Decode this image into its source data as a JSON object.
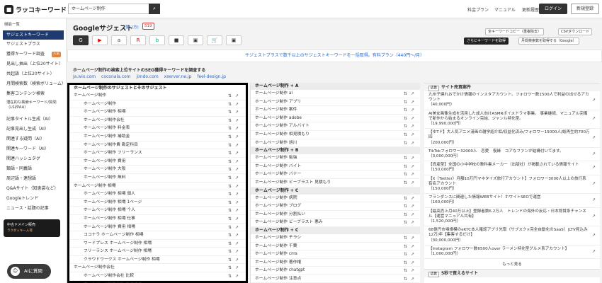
{
  "header": {
    "logo_text": "ラッコキーワード",
    "logo_mark": "■",
    "search_value": "ホームページ制作",
    "nav": [
      "料金プラン",
      "マニュアル",
      "更新履歴"
    ],
    "bell": "♪",
    "login": "ログイン",
    "signup": "新規登録"
  },
  "sidebar": {
    "heading": "機能一覧",
    "items": [
      {
        "label": "サジェストキーワード",
        "active": true
      },
      {
        "label": "サジェストプラス"
      },
      {
        "label": "獲得キーワード調査",
        "badge": "人気"
      },
      {
        "label": "見出し抽出（上位20サイト）"
      },
      {
        "label": "共起語（上位20サイト）"
      },
      {
        "label": "月間検索数（検索ボリューム）"
      },
      {
        "label": "集客コンテンツ検索"
      },
      {
        "label": "潜在的な検索キーワード/質問（LSI/PAA）"
      },
      {
        "label": "記事タイトル生成（AI）"
      },
      {
        "label": "記事見出し生成（AI）"
      },
      {
        "label": "関連する疑問（AI）"
      },
      {
        "label": "関連キーワード（AI）"
      },
      {
        "label": "関連ハッシュタグ"
      },
      {
        "label": "類語・同義語"
      },
      {
        "label": "周辺語・連想語"
      },
      {
        "label": "Q&Aサイト（知恵袋など）"
      },
      {
        "label": "Googleトレンド"
      },
      {
        "label": "ニュース・話題の記事"
      }
    ],
    "promo": {
      "title": "中古ドメイン販売",
      "sub": "ラクダッキー入荷"
    },
    "ai_button": "AIに質問"
  },
  "main": {
    "title": "Googleサジェスト",
    "howto": "(使い方)",
    "count": "519",
    "tools": [
      "G",
      "▶",
      "a",
      "R",
      "b",
      "■",
      "▣",
      "🛒",
      "▣"
    ],
    "right_buttons": {
      "copy": "全キーワードコピー（重複除去）",
      "csv": "CSVダウンロード",
      "more": "さらにキーワードを取得",
      "monthly": "月間検索数を取得する（Google）"
    },
    "info": "サジェストプラスで数千以上のサジェストキーワードを一括取得。有料プラン（440円〜/月）",
    "top_sites_heading": "ホームページ制作の検索上位サイトのSEO獲得キーワードを調査する",
    "top_sites": [
      "ja.wix.com",
      "coconala.com",
      "jimdo.com",
      "xserver.ne.jp",
      "feel-design.jp"
    ]
  },
  "col1": {
    "heading": "ホームページ制作のサジェストとそのサジェスト",
    "rows": [
      {
        "t": "ホームページ制作",
        "l": 0
      },
      {
        "t": "ホームページ制作",
        "l": 1
      },
      {
        "t": "ホームページ制作 相場",
        "l": 1
      },
      {
        "t": "ホームページ制作会社",
        "l": 1
      },
      {
        "t": "ホームページ制作 料金表",
        "l": 1
      },
      {
        "t": "ホームページ制作 補助金",
        "l": 1
      },
      {
        "t": "ホームページ制作費 勘定科目",
        "l": 1
      },
      {
        "t": "ホームページ制作 フリーランス",
        "l": 1
      },
      {
        "t": "ホームページ制作 費用",
        "l": 1
      },
      {
        "t": "ホームページ制作 大阪",
        "l": 1
      },
      {
        "t": "ホームページ制作 無料",
        "l": 1
      },
      {
        "t": "ホームページ制作 相場",
        "l": 0
      },
      {
        "t": "ホームページ制作 相場 個人",
        "l": 1
      },
      {
        "t": "ホームページ制作 相場 1ページ",
        "l": 1
      },
      {
        "t": "ホームページ制作 相場 个人",
        "l": 1
      },
      {
        "t": "ホームページ制作 相場 仕事",
        "l": 1
      },
      {
        "t": "ホームページ制作 費用 相場",
        "l": 1
      },
      {
        "t": "ココナラ ホームページ制作 相場",
        "l": 1
      },
      {
        "t": "ワードプレス ホームページ制作 相場",
        "l": 1
      },
      {
        "t": "フリーランス ホームページ制作 相場",
        "l": 1
      },
      {
        "t": "クラウドワークス ホームページ制作 相場",
        "l": 1
      },
      {
        "t": "ホームページ制作会社",
        "l": 0
      },
      {
        "t": "ホームページ制作会社 比較",
        "l": 1
      },
      {
        "t": "ホームページ制作会社 おすすめ",
        "l": 1
      }
    ]
  },
  "col2": {
    "groups": [
      {
        "heading": "ホームページ制作 + A",
        "rows": [
          "ホームページ制作 ai",
          "ホームページ制作 アプリ",
          "ホームページ制作 案件",
          "ホームページ制作 adobe",
          "ホームページ制作 アルバイト",
          "ホームページ制作 相見積もり",
          "ホームページ制作 旭川"
        ]
      },
      {
        "heading": "ホームページ制作 + B",
        "rows": [
          "ホームページ制作 勉強",
          "ホームページ制作 バイト",
          "ホームページ制作 バナー",
          "ホームページ制作 ビーブラスト 見積もり"
        ]
      },
      {
        "heading": "ホームページ制作 + C",
        "rows": [
          "ホームページ制作 病院",
          "ホームページ制作 ブログ",
          "ホームページ制作 分割払い",
          "ホームページ制作 ビーブラスト 悪み"
        ]
      },
      {
        "heading": "ホームページ制作 + C",
        "rows": [
          "ホームページ制作 チラシ",
          "ホームページ制作 千葉",
          "ホームページ制作 cms",
          "ホームページ制作 著作権",
          "ホームページ制作 chatgpt",
          "ホームページ制作 注意点"
        ]
      }
    ]
  },
  "col3": {
    "heading_tag": "広告",
    "heading": "サイト売買案件",
    "jobs": [
      {
        "text": "九州子連れおでかけ情報のインスタアカウント。フォロワー数1500人で利益の出せるアカウント",
        "price": "（40,000円）"
      },
      {
        "text": "AI美女画像生成を活用した成人向けASMRボイスドラマ事業。 事業継続、マニュアル完備で新作から始まるオンライン完結、ジャンル特化型。",
        "price": "（19,990,000円）"
      },
      {
        "text": "【ゆTド】大人気アニメ漫画の雑学紹介垢/収益化済み/フォロワー15000人/総再生約700万回",
        "price": "（200,000円）"
      },
      {
        "text": "TikTokフォロワー32000人　恋愛　復縁　コアなファンが結構付いてます。",
        "price": "（3,000,000円）"
      },
      {
        "text": "【資産型】全国の小中学校の教科書メーカー（出版社）が掲載されている情報サイト",
        "price": "（150,000円）"
      },
      {
        "text": "【X（Twitter）月額10万円マネタイズ旅行アカウント】フォロワー3000人以上の旅行系有名アカウント",
        "price": "（150,000円）"
      },
      {
        "text": "フランダンスに関連した情報WEBサイト！ホワイトSEOで運営",
        "price": "（160,000円）"
      },
      {
        "text": "【最高売上月40万以上】登録者数6.2万人　トレンドの海外の反応・日本称賛系チャンネル【運営マニュアル共有】",
        "price": "（1,520,000円）"
      },
      {
        "text": "68億円市場規模のeKYC本人確認アプリ先取（サブスク×完全自動化のSaaS）|LTV見込み12万/年【集客するだけ】",
        "price": "（30,000,000円）"
      },
      {
        "text": "【Instagram フォロワー数6500人over ラーメン特化型グルメ系アカウント】",
        "price": "（1,000,000円）"
      }
    ],
    "more": "もっと見る",
    "sec2_tag": "広告",
    "sec2": "5秒で買えるサイト"
  }
}
